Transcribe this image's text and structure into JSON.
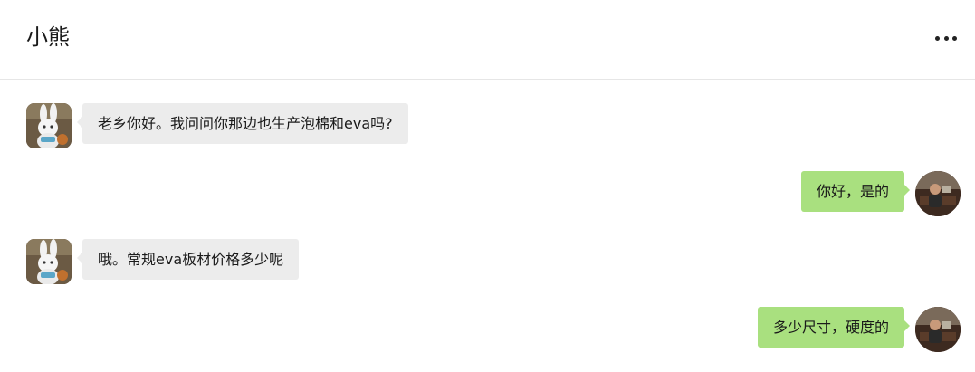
{
  "header": {
    "title": "小熊",
    "more_icon": "more-horizontal-icon"
  },
  "messages": [
    {
      "direction": "incoming",
      "avatar": "rabbit-avatar",
      "text": "老乡你好。我问问你那边也生产泡棉和eva吗?"
    },
    {
      "direction": "outgoing",
      "avatar": "person-avatar",
      "text": "你好，是的"
    },
    {
      "direction": "incoming",
      "avatar": "rabbit-avatar",
      "text": "哦。常规eva板材价格多少呢"
    },
    {
      "direction": "outgoing",
      "avatar": "person-avatar",
      "text": "多少尺寸，硬度的"
    }
  ],
  "colors": {
    "incoming_bubble": "#ececec",
    "outgoing_bubble": "#a9e07f",
    "divider": "#e6e6e6"
  }
}
